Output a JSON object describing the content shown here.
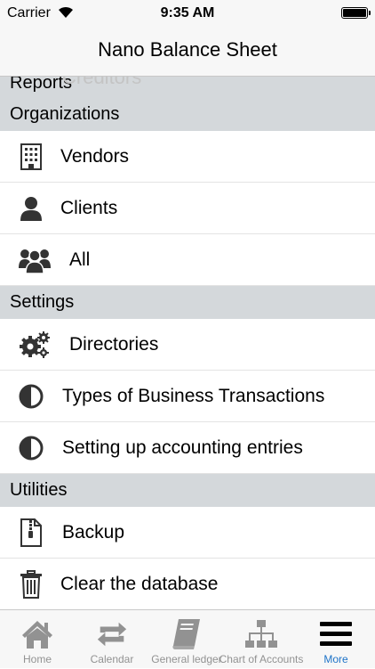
{
  "status_bar": {
    "carrier": "Carrier",
    "time": "9:35 AM"
  },
  "nav": {
    "title": "Nano Balance Sheet"
  },
  "ghost_text": "Creditors",
  "sections": {
    "reports": {
      "title": "Reports"
    },
    "organizations": {
      "title": "Organizations",
      "items": [
        {
          "label": "Vendors",
          "icon": "building-icon"
        },
        {
          "label": "Clients",
          "icon": "person-icon"
        },
        {
          "label": "All",
          "icon": "group-icon"
        }
      ]
    },
    "settings": {
      "title": "Settings",
      "items": [
        {
          "label": "Directories",
          "icon": "gears-icon"
        },
        {
          "label": "Types of Business Transactions",
          "icon": "half-circle-icon"
        },
        {
          "label": "Setting up accounting entries",
          "icon": "half-circle-icon"
        }
      ]
    },
    "utilities": {
      "title": "Utilities",
      "items": [
        {
          "label": "Backup",
          "icon": "zip-file-icon"
        },
        {
          "label": "Clear the database",
          "icon": "trash-icon"
        }
      ]
    }
  },
  "tab_bar": {
    "tabs": [
      {
        "label": "Home",
        "icon": "home-icon"
      },
      {
        "label": "Calendar",
        "icon": "repeat-icon"
      },
      {
        "label": "General ledger",
        "icon": "book-icon"
      },
      {
        "label": "Chart of Accounts",
        "icon": "hierarchy-icon"
      },
      {
        "label": "More",
        "icon": "menu-icon"
      }
    ],
    "active": "More",
    "active_color": "#1e73c8",
    "inactive_color": "#929292"
  }
}
